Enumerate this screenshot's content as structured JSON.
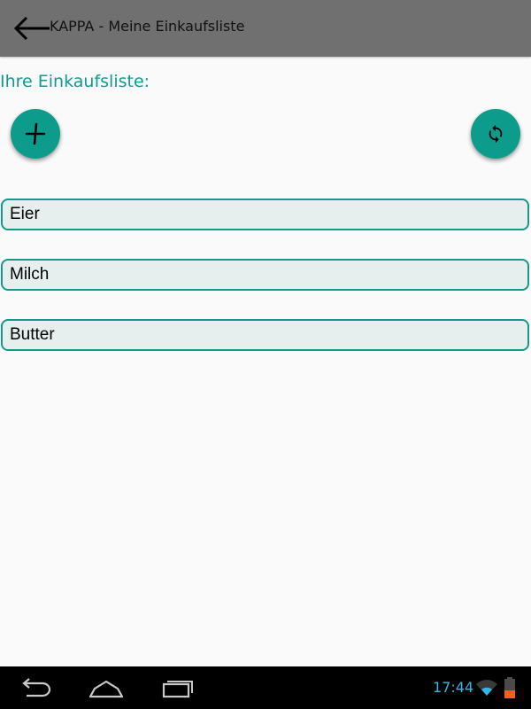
{
  "header": {
    "title": "KAPPA - Meine Einkaufsliste",
    "back_icon": "back-arrow-icon"
  },
  "main": {
    "heading": "Ihre Einkaufsliste:",
    "add_icon": "plus-icon",
    "refresh_icon": "refresh-icon",
    "items": [
      {
        "label": "Eier"
      },
      {
        "label": "Milch"
      },
      {
        "label": "Butter"
      }
    ]
  },
  "status_bar": {
    "time": "17:44",
    "wifi_icon": "wifi-icon",
    "battery_icon": "battery-icon"
  },
  "system_nav": {
    "back_icon": "nav-back-icon",
    "home_icon": "nav-home-icon",
    "recents_icon": "nav-recents-icon"
  },
  "colors": {
    "accent": "#119a8e",
    "fab": "#0d9c8c",
    "app_bar": "#707070",
    "item_border": "#16998a",
    "item_background": "#e6efee",
    "clock": "#33b5e5",
    "battery_level": "#ff5a1f"
  }
}
